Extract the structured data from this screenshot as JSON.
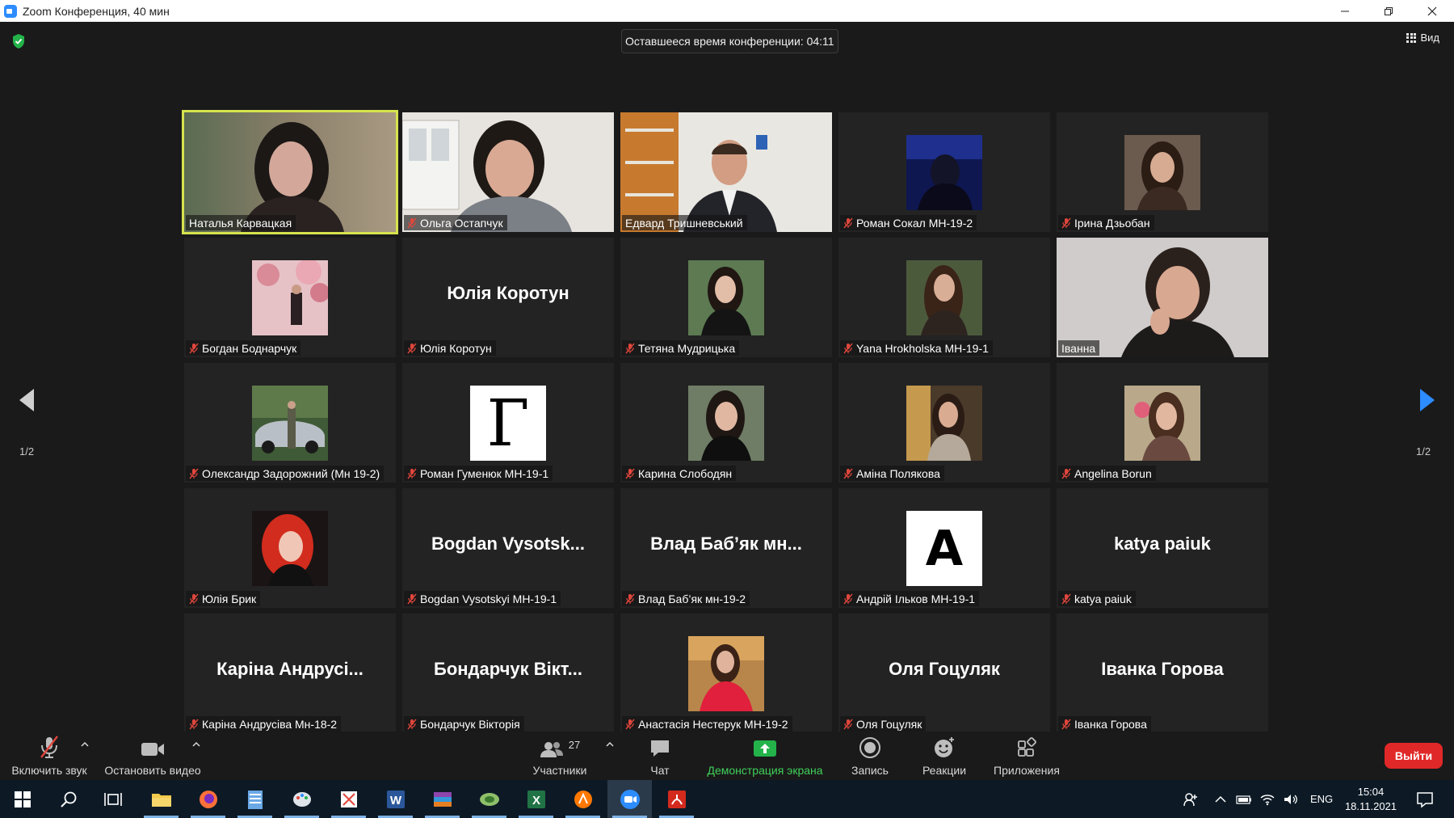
{
  "window": {
    "title": "Zoom Конференция, 40 мин"
  },
  "meeting": {
    "timer": "Оставшееся время конференции: 04:11",
    "view_label": "Вид",
    "page_left": "1/2",
    "page_right": "1/2"
  },
  "tiles": [
    {
      "name": "Наталья Карвацкая",
      "muted": false
    },
    {
      "name": "Ольга Остапчук",
      "muted": true
    },
    {
      "name": "Едвард Тришневський",
      "muted": false
    },
    {
      "name": "Роман Сокал МН-19-2",
      "muted": true
    },
    {
      "name": "Ірина Дзьобан",
      "muted": true
    },
    {
      "name": "Богдан Боднарчук",
      "muted": true
    },
    {
      "name": "Юлія Коротун",
      "display": "Юлія Коротун",
      "muted": true
    },
    {
      "name": "Тетяна Мудрицька",
      "muted": true
    },
    {
      "name": "Yana Hrokholska МН-19-1",
      "muted": true
    },
    {
      "name": "Іванна",
      "muted": false
    },
    {
      "name": "Олександр Задорожний (Мн 19-2)",
      "muted": true
    },
    {
      "name": "Роман Гуменюк МН-19-1",
      "letter": "Г",
      "muted": true
    },
    {
      "name": "Карина Слободян",
      "muted": true
    },
    {
      "name": "Аміна Полякова",
      "muted": true
    },
    {
      "name": "Angelina Borun",
      "muted": true
    },
    {
      "name": "Юлія Брик",
      "muted": true
    },
    {
      "name": "Bogdan Vysotskyi МН-19-1",
      "display": "Bogdan  Vysotsk...",
      "muted": true
    },
    {
      "name": "Влад Баб’як мн-19-2",
      "display": "Влад  Баб’як  мн...",
      "muted": true
    },
    {
      "name": "Андрій Ільков МН-19-1",
      "letter": "A",
      "muted": true
    },
    {
      "name": "katya paiuk",
      "display": "katya  paiuk",
      "muted": true
    },
    {
      "name": "Каріна Андрусіва Мн-18-2",
      "display": "Каріна  Андрусі...",
      "muted": true
    },
    {
      "name": "Бондарчук Вікторія",
      "display": "Бондарчук  Вікт...",
      "muted": true
    },
    {
      "name": "Анастасія Нестерук МН-19-2",
      "muted": true
    },
    {
      "name": "Оля Гоцуляк",
      "display": "Оля  Гоцуляк",
      "muted": true
    },
    {
      "name": "Іванка Горова",
      "display": "Іванка  Горова",
      "muted": true
    }
  ],
  "toolbar": {
    "unmute_label": "Включить звук",
    "stop_video_label": "Остановить видео",
    "participants_label": "Участники",
    "participants_count": "27",
    "chat_label": "Чат",
    "share_label": "Демонстрация экрана",
    "record_label": "Запись",
    "reactions_label": "Реакции",
    "apps_label": "Приложения",
    "leave_label": "Выйти"
  },
  "taskbar": {
    "lang": "ENG",
    "time": "15:04",
    "date": "18.11.2021"
  },
  "colors": {
    "active_speaker": "#d6e34d",
    "leave": "#e02828",
    "share_green": "#3fd15a",
    "zoom_blue": "#2d8cff",
    "mute_red": "#e0463c"
  }
}
